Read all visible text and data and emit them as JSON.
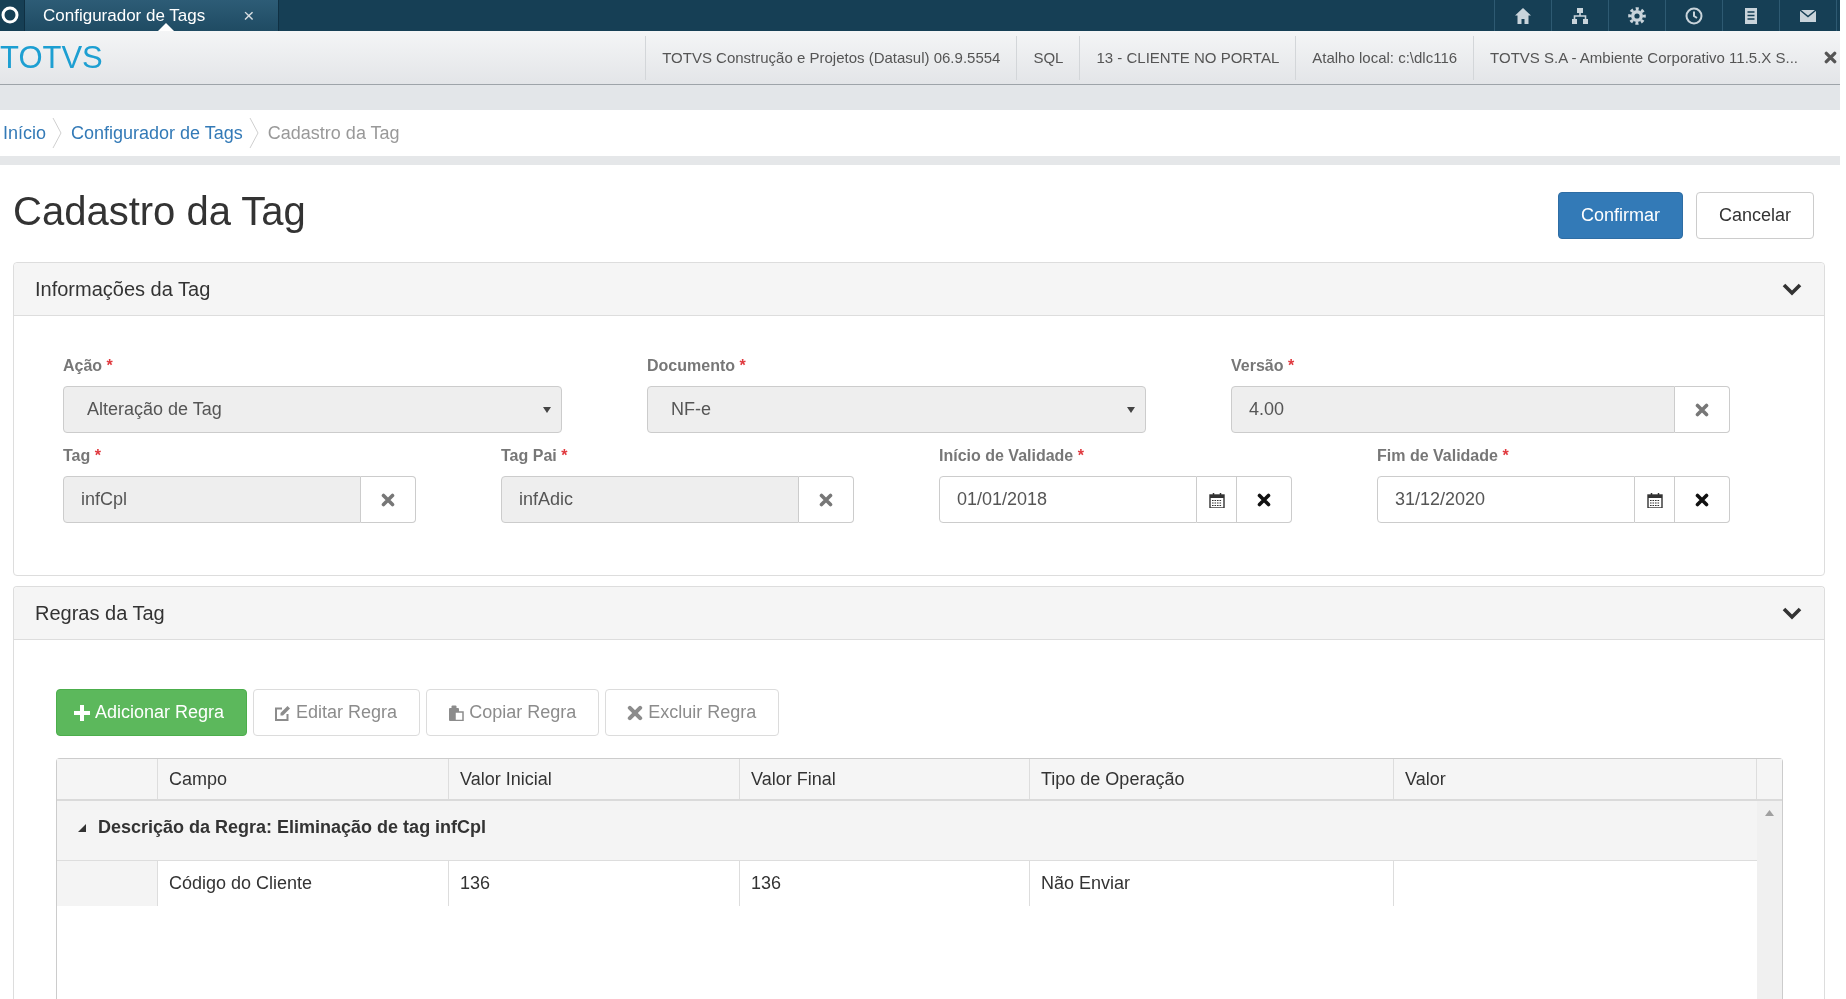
{
  "top_bar": {
    "tabs": [
      {
        "label": "Configurador de Tags",
        "close": "×",
        "selected": true
      }
    ]
  },
  "header": {
    "logo": "TOTVS",
    "info": [
      "TOTVS Construção e Projetos (Datasul) 06.9.5554",
      "SQL",
      "13 - CLIENTE NO PORTAL",
      "Atalho local: c:\\dlc116",
      "TOTVS S.A - Ambiente Corporativo 11.5.X S..."
    ]
  },
  "breadcrumb": [
    {
      "label": "Início",
      "current": false
    },
    {
      "label": "Configurador de Tags",
      "current": false
    },
    {
      "label": "Cadastro da Tag",
      "current": true
    }
  ],
  "page": {
    "title": "Cadastro da Tag",
    "actions": [
      {
        "label": "Confirmar",
        "kind": "primary"
      },
      {
        "label": "Cancelar",
        "kind": "default"
      }
    ]
  },
  "info_panel": {
    "title": "Informações da Tag",
    "expanded": true,
    "rows": [
      [
        {
          "label": "Ação",
          "required_mark": "*",
          "kind": "select",
          "value": "Alteração de Tag",
          "disabled": true
        },
        {
          "label": "Documento",
          "required_mark": "*",
          "kind": "select",
          "value": "NF-e",
          "disabled": true
        },
        {
          "label": "Versão",
          "required_mark": "*",
          "kind": "clearable",
          "value": "4.00",
          "disabled": true
        }
      ],
      [
        {
          "label": "Tag",
          "required_mark": "*",
          "kind": "clearable",
          "value": "infCpl",
          "disabled": true
        },
        {
          "label": "Tag Pai",
          "required_mark": "*",
          "kind": "clearable",
          "value": "infAdic",
          "disabled": true
        },
        {
          "label": "Início de Validade",
          "required_mark": "*",
          "kind": "date",
          "value": "01/01/2018",
          "disabled": false
        },
        {
          "label": "Fim de Validade",
          "required_mark": "*",
          "kind": "date",
          "value": "31/12/2020",
          "disabled": false
        }
      ]
    ]
  },
  "rules_panel": {
    "title": "Regras da Tag",
    "expanded": true,
    "toolbar": [
      {
        "label": "Adicionar Regra",
        "kind": "add",
        "disabled": false
      },
      {
        "label": "Editar Regra",
        "kind": "edit",
        "disabled": true
      },
      {
        "label": "Copiar Regra",
        "kind": "copy",
        "disabled": true
      },
      {
        "label": "Excluir Regra",
        "kind": "delete",
        "disabled": true
      }
    ],
    "table": {
      "columns": [
        "Campo",
        "Valor Inicial",
        "Valor Final",
        "Tipo de Operação",
        "Valor"
      ],
      "groups": [
        {
          "label": "Descrição da Regra: Eliminação de tag infCpl",
          "expanded": true,
          "rows": [
            {
              "cells": [
                "Código do Cliente",
                "136",
                "136",
                "Não Enviar"
              ]
            }
          ]
        }
      ]
    }
  }
}
